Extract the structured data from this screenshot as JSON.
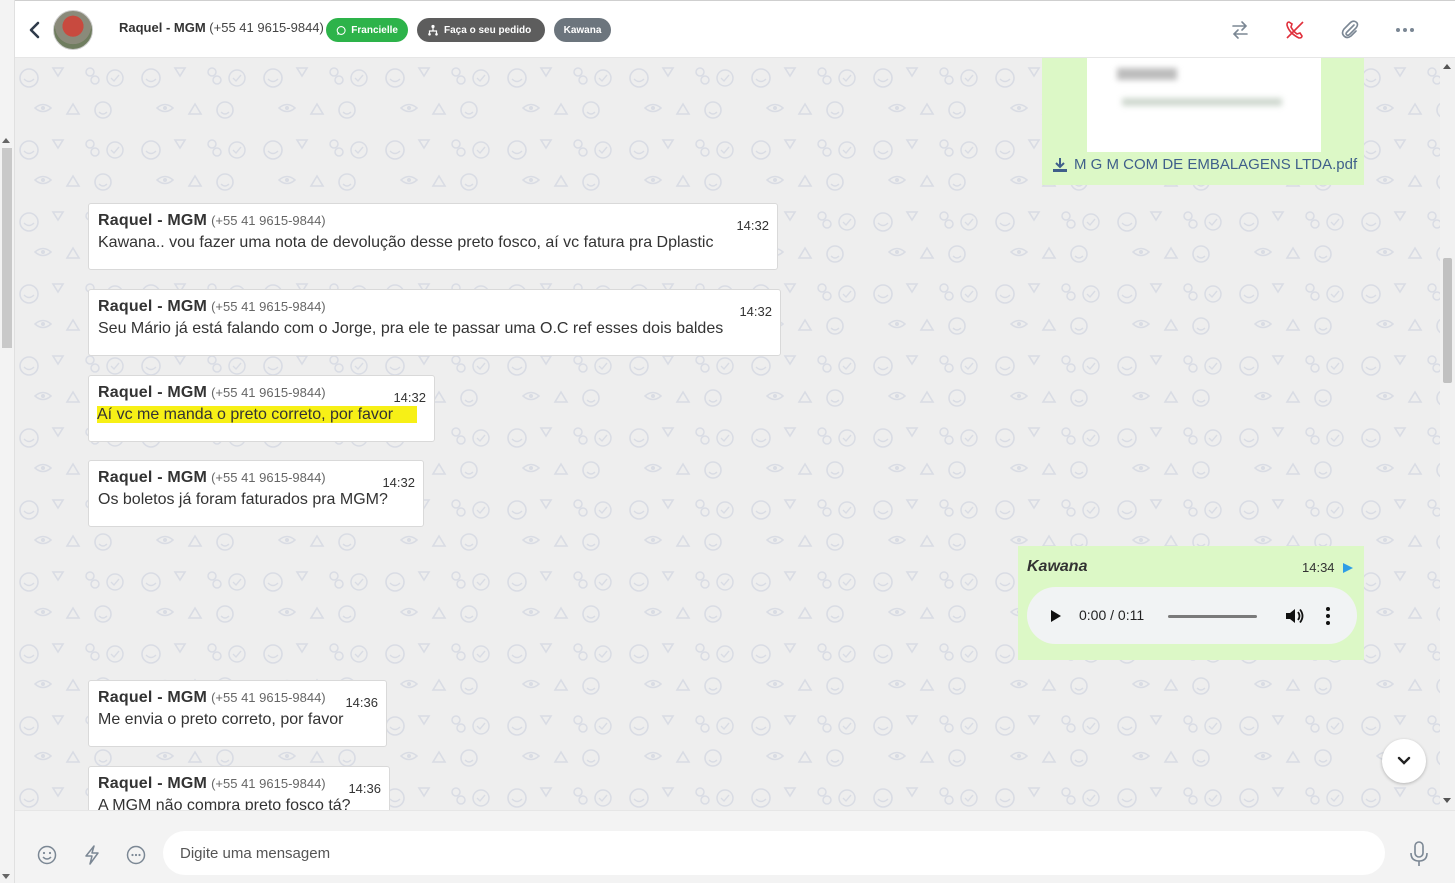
{
  "header": {
    "contact_name": "Raquel - MGM",
    "contact_phone": "(+55 41 9615-9844)",
    "tags": [
      {
        "label": "Francielle",
        "icon": "whatsapp-icon",
        "color": "#2db34a"
      },
      {
        "label": "Faça o seu pedido",
        "icon": "flow-icon",
        "color": "#5d5d5d"
      },
      {
        "label": "Kawana",
        "color": "#6c757d"
      }
    ]
  },
  "messages": [
    {
      "sender": "Raquel - MGM",
      "phone": "(+55 41 9615-9844)",
      "time": "14:32",
      "text": "Kawana.. vou fazer uma nota de devolução desse preto fosco, aí vc fatura pra Dplastic"
    },
    {
      "sender": "Raquel - MGM",
      "phone": "(+55 41 9615-9844)",
      "time": "14:32",
      "text": "Seu Mário já está falando com o Jorge, pra ele te passar uma O.C ref esses dois baldes"
    },
    {
      "sender": "Raquel - MGM",
      "phone": "(+55 41 9615-9844)",
      "time": "14:32",
      "text": "Aí vc me manda o preto correto, por favor"
    },
    {
      "sender": "Raquel - MGM",
      "phone": "(+55 41 9615-9844)",
      "time": "14:32",
      "text": "Os boletos já foram faturados pra MGM?"
    },
    {
      "sender": "Raquel - MGM",
      "phone": "(+55 41 9615-9844)",
      "time": "14:36",
      "text": "Me envia o preto correto, por favor"
    },
    {
      "sender": "Raquel - MGM",
      "phone": "(+55 41 9615-9844)",
      "time": "14:36",
      "text": "A MGM não compra preto fosco tá?"
    }
  ],
  "outgoing_pdf": {
    "filename": "M G M COM DE EMBALAGENS LTDA.pdf"
  },
  "outgoing_audio": {
    "agent": "Kawana",
    "time": "14:34",
    "timecode": "0:00 / 0:11"
  },
  "composer": {
    "placeholder": "Digite uma mensagem"
  },
  "colors": {
    "outgoing": "#dcf8c6",
    "accent_red": "#e0303c",
    "highlight": "#f7f016"
  }
}
